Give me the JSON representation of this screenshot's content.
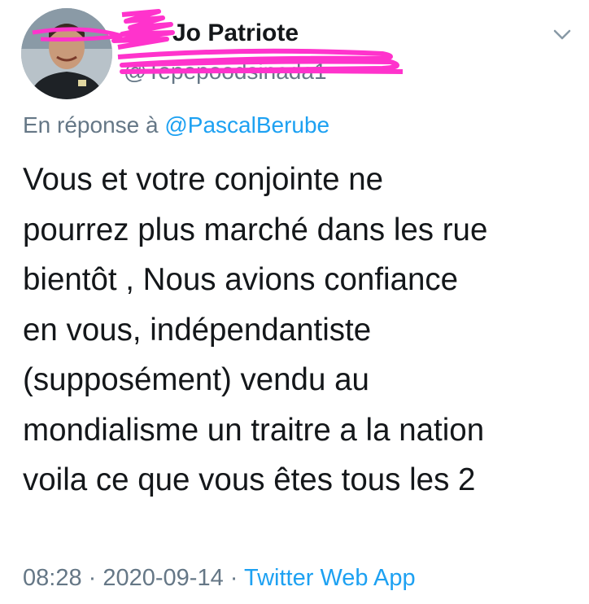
{
  "tweet": {
    "author_name": "Patriote",
    "author_name_prefix": "Jo",
    "handle": "@Tepepoodsinada1",
    "reply_prefix": "En réponse à",
    "reply_mention": "@PascalBerube",
    "text_lines": [
      "Vous et votre conjointe ne",
      "pourrez plus marché dans les rue",
      "bientôt , Nous avions confiance",
      "en vous, indépendantiste",
      "(supposément) vendu au",
      "mondialisme un traitre a la nation",
      "voila ce que vous êtes tous les 2"
    ],
    "time": "08:28",
    "separator": "·",
    "date": "2020-09-14",
    "source": "Twitter Web App"
  },
  "icons": {
    "menu": "chevron-down-icon",
    "avatar": "profile-photo"
  },
  "colors": {
    "text": "#14171a",
    "secondary": "#657786",
    "link": "#1da1f2",
    "redaction": "#ff33cc"
  }
}
